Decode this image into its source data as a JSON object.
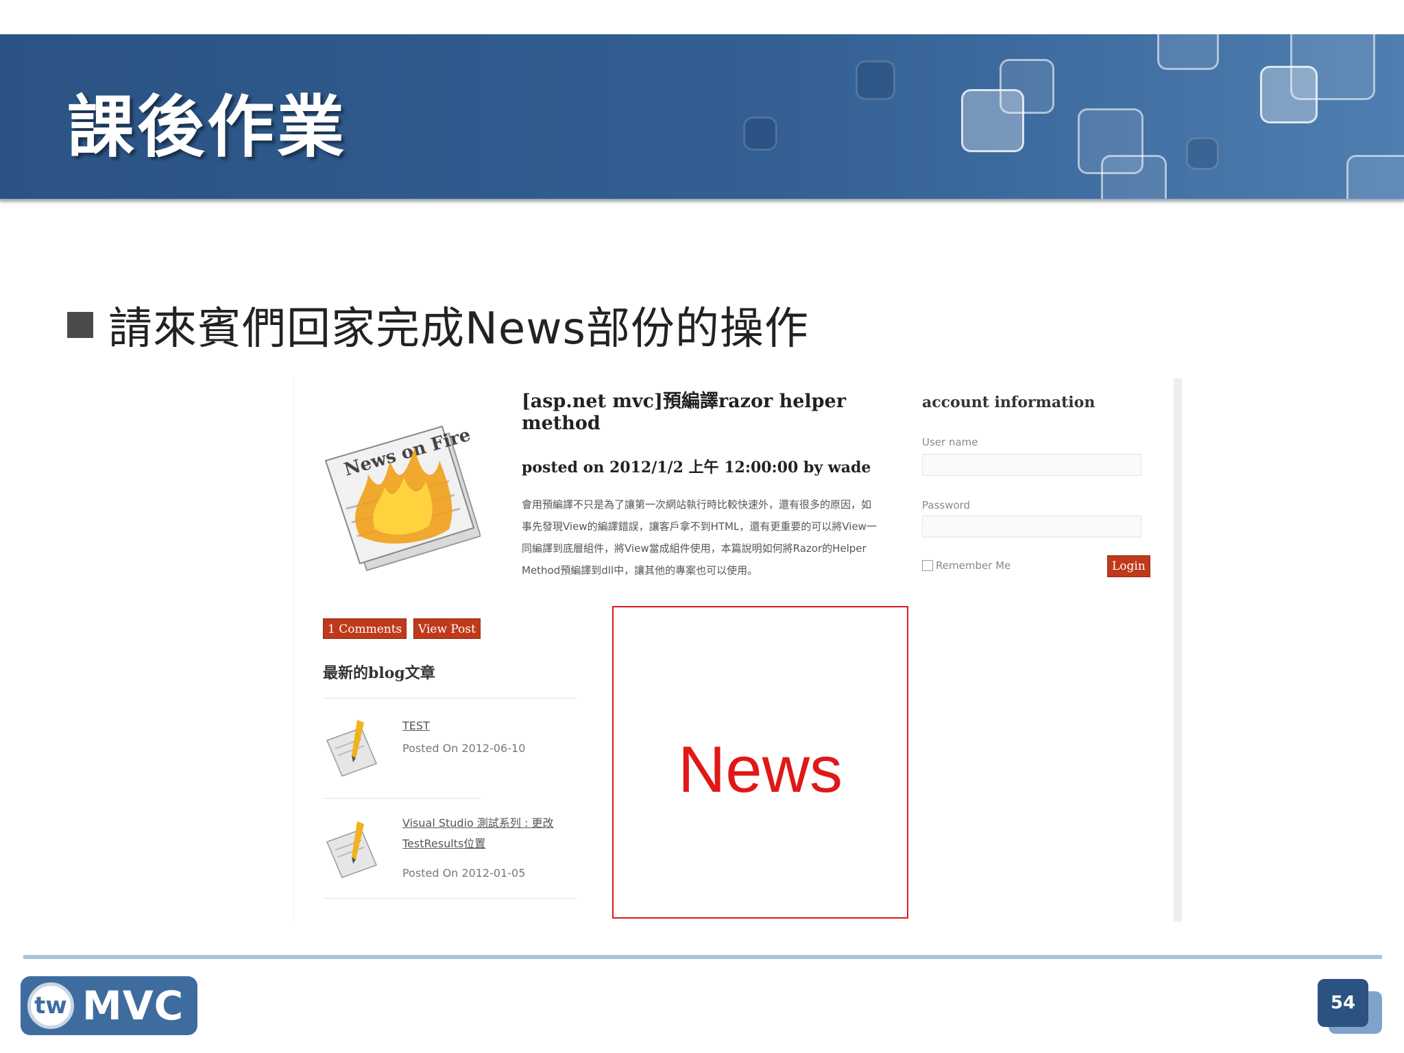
{
  "slide": {
    "title": "課後作業",
    "bullet": "請來賓們回家完成News部份的操作",
    "page_number": "54",
    "logo": {
      "mark": "tw",
      "text": "MVC"
    }
  },
  "screenshot": {
    "post": {
      "title": "[asp.net mvc]預編譯razor helper method",
      "meta": "posted on 2012/1/2 上午 12:00:00 by wade",
      "excerpt": "會用預編譯不只是為了讓第一次網站執行時比較快速外，還有很多的原因，如事先發現View的編譯錯誤，讓客戶拿不到HTML，還有更重要的可以將View一同編譯到底層組件，將View當成組件使用，本篇說明如何將Razor的Helper Method預編譯到dll中，讓其他的專案也可以使用。",
      "comments_button": "1 Comments",
      "view_button": "View Post"
    },
    "latest": {
      "heading": "最新的blog文章",
      "items": [
        {
          "title": "TEST",
          "date": "Posted On 2012-06-10"
        },
        {
          "title": "Visual Studio 測試系列 : 更改TestResults位置",
          "date": "Posted On 2012-01-05"
        }
      ]
    },
    "news_placeholder": "News",
    "account": {
      "heading": "account information",
      "username_label": "User name",
      "password_label": "Password",
      "remember_label": "Remember Me",
      "login_button": "Login"
    }
  },
  "colors": {
    "header_blue": "#2b5384",
    "news_red": "#e01818",
    "button_red": "#c0391b"
  }
}
